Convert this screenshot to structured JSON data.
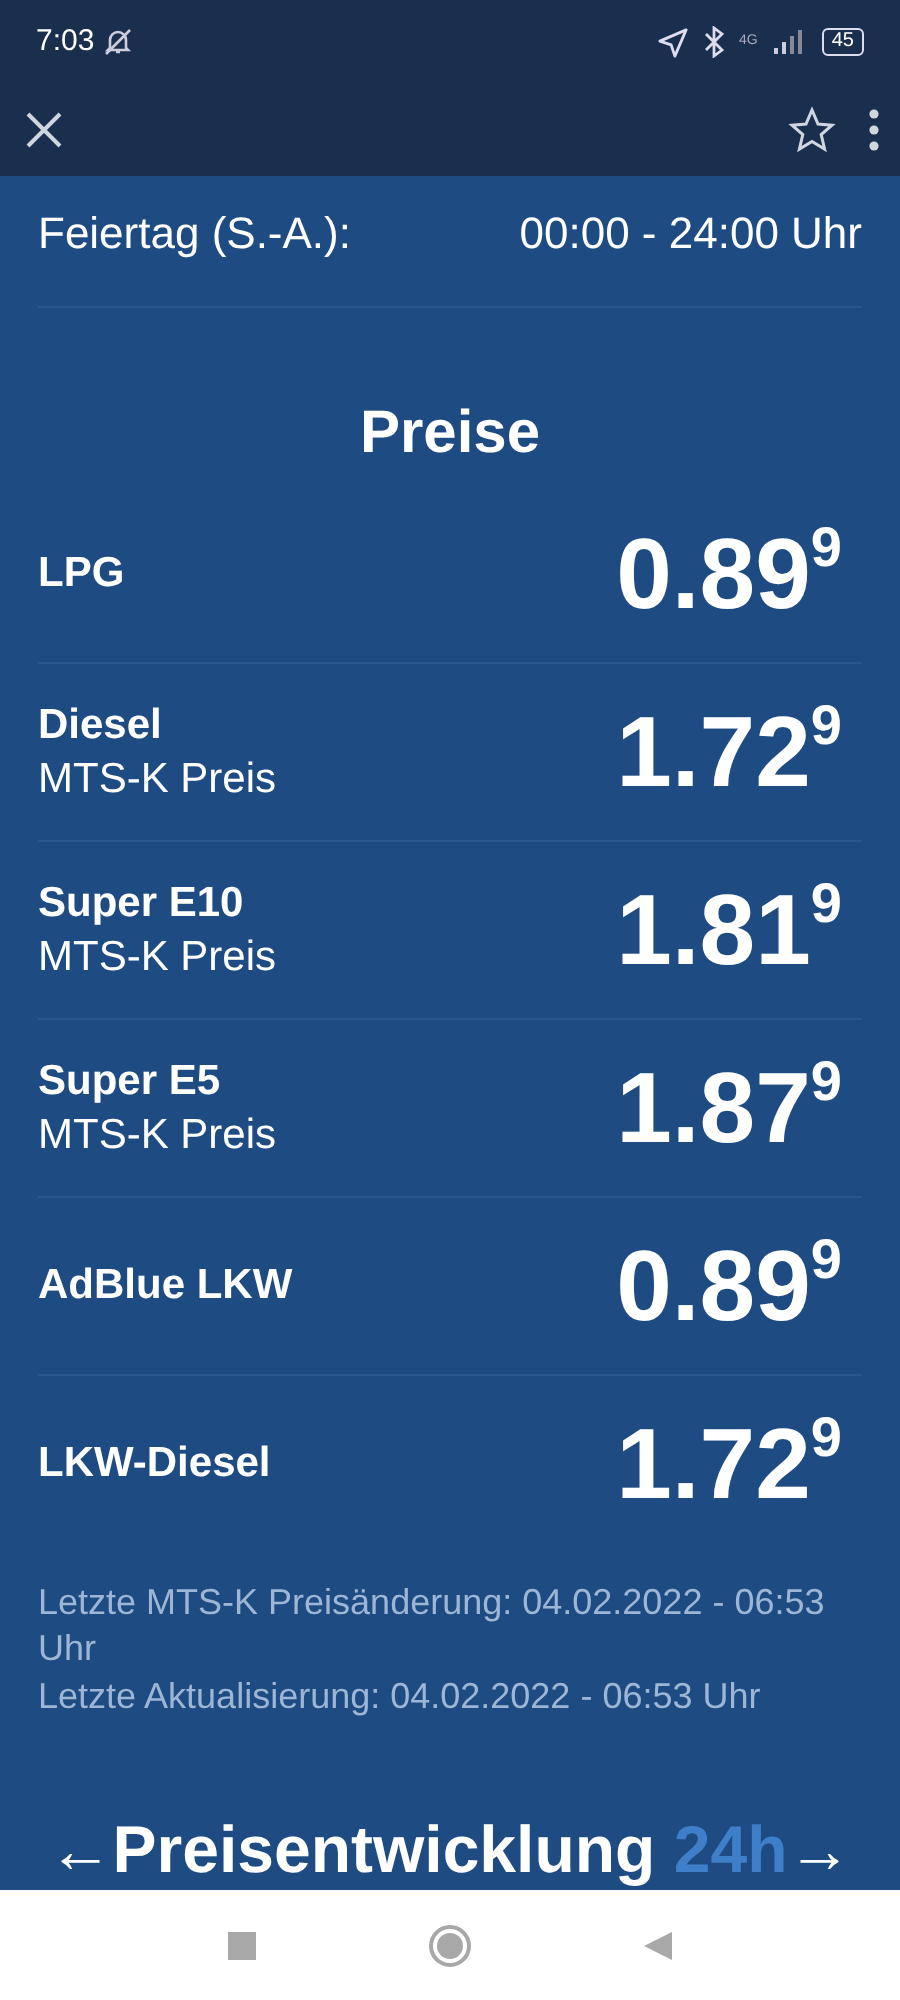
{
  "status_bar": {
    "time": "7:03",
    "signal_label": "4G",
    "battery": "45"
  },
  "hours": [
    {
      "day": "Feiertag (S.-A.):",
      "time": "00:00 - 24:00 Uhr"
    }
  ],
  "prices_title": "Preise",
  "prices": [
    {
      "fuel": "LPG",
      "price": "0.89",
      "digit": "9"
    },
    {
      "fuel": "Diesel",
      "note": "MTS-K Preis",
      "price": "1.72",
      "digit": "9"
    },
    {
      "fuel": "Super E10",
      "note": "MTS-K Preis",
      "price": "1.81",
      "digit": "9"
    },
    {
      "fuel": "Super E5",
      "note": "MTS-K Preis",
      "price": "1.87",
      "digit": "9"
    },
    {
      "fuel": "AdBlue LKW",
      "price": "0.89",
      "digit": "9"
    },
    {
      "fuel": "LKW-Diesel",
      "price": "1.72",
      "digit": "9"
    }
  ],
  "footer_notes": [
    "Letzte MTS-K Preisänderung: 04.02.2022 - 06:53 Uhr",
    "Letzte Aktualisierung: 04.02.2022 - 06:53 Uhr"
  ],
  "trend": {
    "prev": "←",
    "title": "Preisentwicklung",
    "period": "24h",
    "next": "→"
  }
}
